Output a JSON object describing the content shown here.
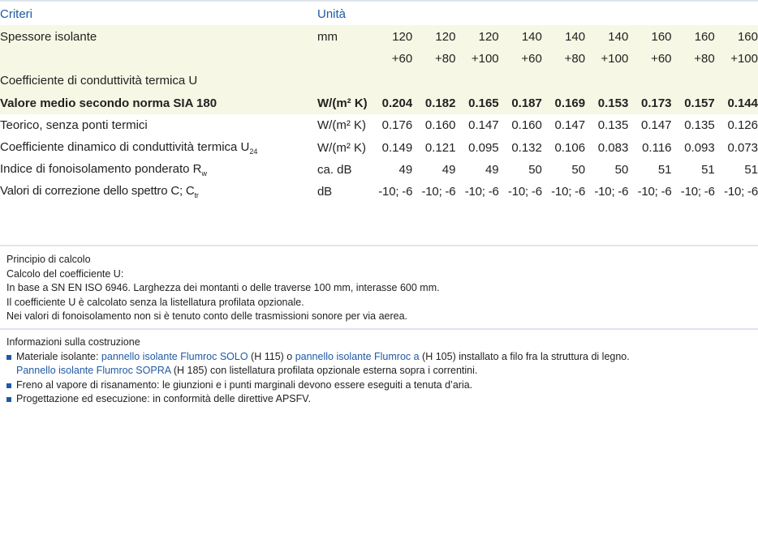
{
  "table": {
    "header": {
      "criteri": "Criteri",
      "unita": "Unità"
    },
    "spessore": {
      "label": "Spessore isolante",
      "unit": "mm",
      "top": [
        "120",
        "120",
        "120",
        "140",
        "140",
        "140",
        "160",
        "160",
        "160"
      ],
      "bottom": [
        "+60",
        "+80",
        "+100",
        "+60",
        "+80",
        "+100",
        "+60",
        "+80",
        "+100"
      ]
    },
    "coeff_title": "Coefficiente di conduttività termica U",
    "rows": [
      {
        "label": "Valore medio secondo norma SIA 180",
        "unit": "W/(m² K)",
        "values": [
          "0.204",
          "0.182",
          "0.165",
          "0.187",
          "0.169",
          "0.153",
          "0.173",
          "0.157",
          "0.144"
        ]
      },
      {
        "label": "Teorico, senza ponti termici",
        "unit": "W/(m² K)",
        "values": [
          "0.176",
          "0.160",
          "0.147",
          "0.160",
          "0.147",
          "0.135",
          "0.147",
          "0.135",
          "0.126"
        ]
      },
      {
        "label": "Coefficiente dinamico di conduttività termica U",
        "sub": "24",
        "unit": "W/(m² K)",
        "values": [
          "0.149",
          "0.121",
          "0.095",
          "0.132",
          "0.106",
          "0.083",
          "0.116",
          "0.093",
          "0.073"
        ]
      },
      {
        "label": "Indice di fonoisolamento ponderato R",
        "sub": "w",
        "unit": "ca. dB",
        "values": [
          "49",
          "49",
          "49",
          "50",
          "50",
          "50",
          "51",
          "51",
          "51"
        ]
      },
      {
        "label": "Valori di correzione dello spettro C; C",
        "sub": "tr",
        "unit": "dB",
        "values": [
          "-10; -6",
          "-10; -6",
          "-10; -6",
          "-10; -6",
          "-10; -6",
          "-10; -6",
          "-10; -6",
          "-10; -6",
          "-10; -6"
        ]
      }
    ]
  },
  "calcolo": {
    "title": "Principio di calcolo",
    "lines": [
      "Calcolo del coefficiente U:",
      "In base a SN EN ISO 6946. Larghezza dei montanti o delle traverse 100 mm, interasse 600 mm.",
      "Il coefficiente U è calcolato senza la listellatura profilata opzionale.",
      "Nei valori di fonoisolamento non si è tenuto conto delle trasmissioni sonore per via aerea."
    ]
  },
  "costruzione": {
    "title": "Informazioni sulla costruzione",
    "b1": {
      "t1": "Materiale isolante: ",
      "l1": "pannello isolante Flumroc SOLO",
      "t2": " (H 115) o ",
      "l2": "pannello isolante Flumroc a",
      "t3": " (H 105) installato a filo fra la struttura di legno.",
      "l3": "Pannello isolante Flumroc SOPRA",
      "t4": " (H 185) con listellatura profilata opzionale esterna sopra i correntini."
    },
    "b2": "Freno al vapore di risanamento: le giunzioni e i punti marginali devono essere eseguiti a tenuta d’aria.",
    "b3": "Progettazione ed esecuzione: in conformità delle direttive APSFV."
  },
  "colors": {
    "accent": "#1f5aa5",
    "shade": "#f6f7e4",
    "rule": "#dfe4ec"
  }
}
